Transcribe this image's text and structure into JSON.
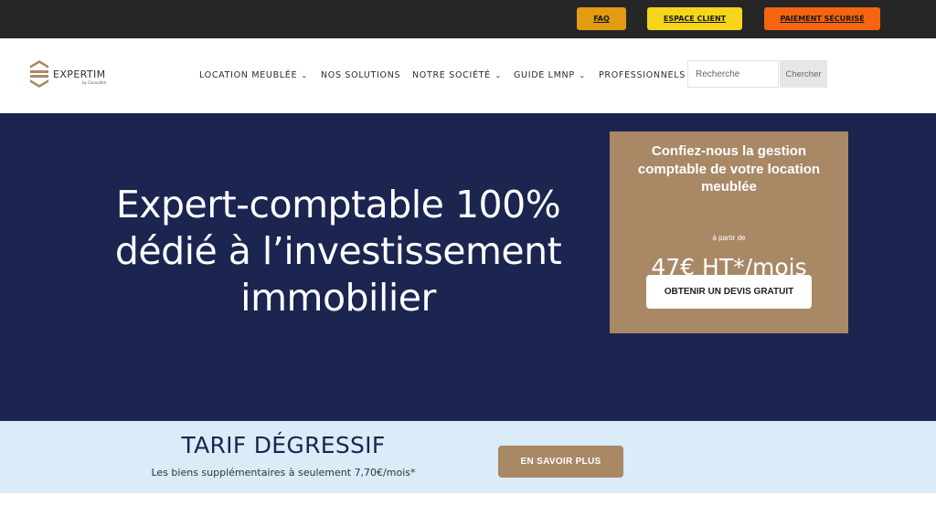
{
  "topbar": {
    "faq": "FAQ",
    "espace_client": "ESPACE CLIENT",
    "paiement": "PAIEMENT SÉCURISÉ"
  },
  "header": {
    "logo_name": "EXPERTIM",
    "logo_sub": "by Consultim",
    "nav": [
      {
        "label": "LOCATION MEUBLÉE",
        "has_dropdown": true
      },
      {
        "label": "NOS SOLUTIONS",
        "has_dropdown": false
      },
      {
        "label": "NOTRE SOCIÉTÉ",
        "has_dropdown": true
      },
      {
        "label": "GUIDE LMNP",
        "has_dropdown": true
      },
      {
        "label": "PROFESSIONNELS",
        "has_dropdown": false
      }
    ],
    "search_placeholder": "Recherche",
    "search_button": "Chercher"
  },
  "hero": {
    "title": "Expert-comptable 100% dédié à l’investissement immobilier",
    "cta_heading": "Confiez-nous la gestion comptable de votre location meublée",
    "cta_from": "à partir de",
    "cta_price": "47€ HT*/mois",
    "cta_button": "OBTENIR UN DEVIS GRATUIT"
  },
  "band": {
    "title": "TARIF DÉGRESSIF",
    "subtitle": "Les biens supplémentaires à seulement 7,70€/mois*",
    "button": "EN SAVOIR PLUS"
  },
  "colors": {
    "topbar_bg": "#262626",
    "faq": "#e39b12",
    "espace_client": "#f7d51b",
    "paiement": "#f56410",
    "navy": "#1b2550",
    "gold": "#a98866",
    "band_bg": "#d9ecf8"
  },
  "icons": {
    "logo": "expertim-logo-icon",
    "dropdown": "chevron-down-icon"
  }
}
